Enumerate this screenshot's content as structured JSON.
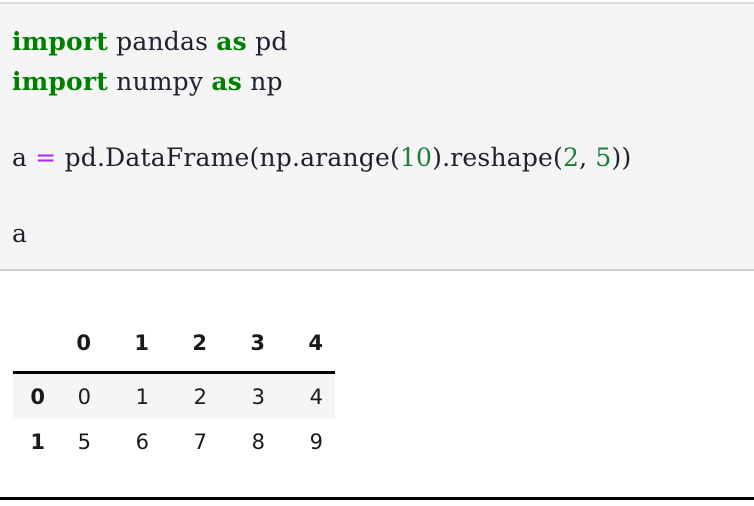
{
  "notebook": {
    "code_cell": {
      "background_color": "#f5f5f5",
      "lines": [
        {
          "id": "line-1",
          "tokens": [
            {
              "text": "import",
              "type": "keyword"
            },
            {
              "text": " pandas ",
              "type": "plain"
            },
            {
              "text": "as",
              "type": "keyword"
            },
            {
              "text": " pd",
              "type": "plain"
            }
          ],
          "text": "import pandas as pd"
        },
        {
          "id": "line-2",
          "tokens": [
            {
              "text": "import",
              "type": "keyword"
            },
            {
              "text": " numpy ",
              "type": "plain"
            },
            {
              "text": "as",
              "type": "keyword"
            },
            {
              "text": " np",
              "type": "plain"
            }
          ],
          "text": "import numpy as np"
        },
        {
          "id": "line-3",
          "tokens": [],
          "text": ""
        },
        {
          "id": "line-4",
          "tokens": [
            {
              "text": "a ",
              "type": "plain"
            },
            {
              "text": "=",
              "type": "operator"
            },
            {
              "text": " pd.DataFrame(np.arange(",
              "type": "plain"
            },
            {
              "text": "10",
              "type": "number"
            },
            {
              "text": ").reshape(",
              "type": "plain"
            },
            {
              "text": "2",
              "type": "number"
            },
            {
              "text": ", ",
              "type": "plain"
            },
            {
              "text": "5",
              "type": "number"
            },
            {
              "text": "))",
              "type": "plain"
            }
          ],
          "text": "a = pd.DataFrame(np.arange(10).reshape(2, 5))"
        },
        {
          "id": "line-5",
          "tokens": [],
          "text": ""
        },
        {
          "id": "line-6",
          "tokens": [
            {
              "text": "a",
              "type": "plain"
            }
          ],
          "text": "a"
        }
      ]
    },
    "output": {
      "type": "dataframe",
      "corner_label": "",
      "column_headers": [
        "0",
        "1",
        "2",
        "3",
        "4"
      ],
      "rows": [
        {
          "index": "0",
          "values": [
            "0",
            "1",
            "2",
            "3",
            "4"
          ],
          "striped": true
        },
        {
          "index": "1",
          "values": [
            "5",
            "6",
            "7",
            "8",
            "9"
          ],
          "striped": false
        }
      ]
    }
  },
  "colors": {
    "keyword": "#008000",
    "operator": "#aa22ff",
    "number": "#1a7f37",
    "plain_text": "#202030",
    "cell_background": "#f5f5f5",
    "stripe_background": "#f5f5f5",
    "rule": "#000000"
  }
}
